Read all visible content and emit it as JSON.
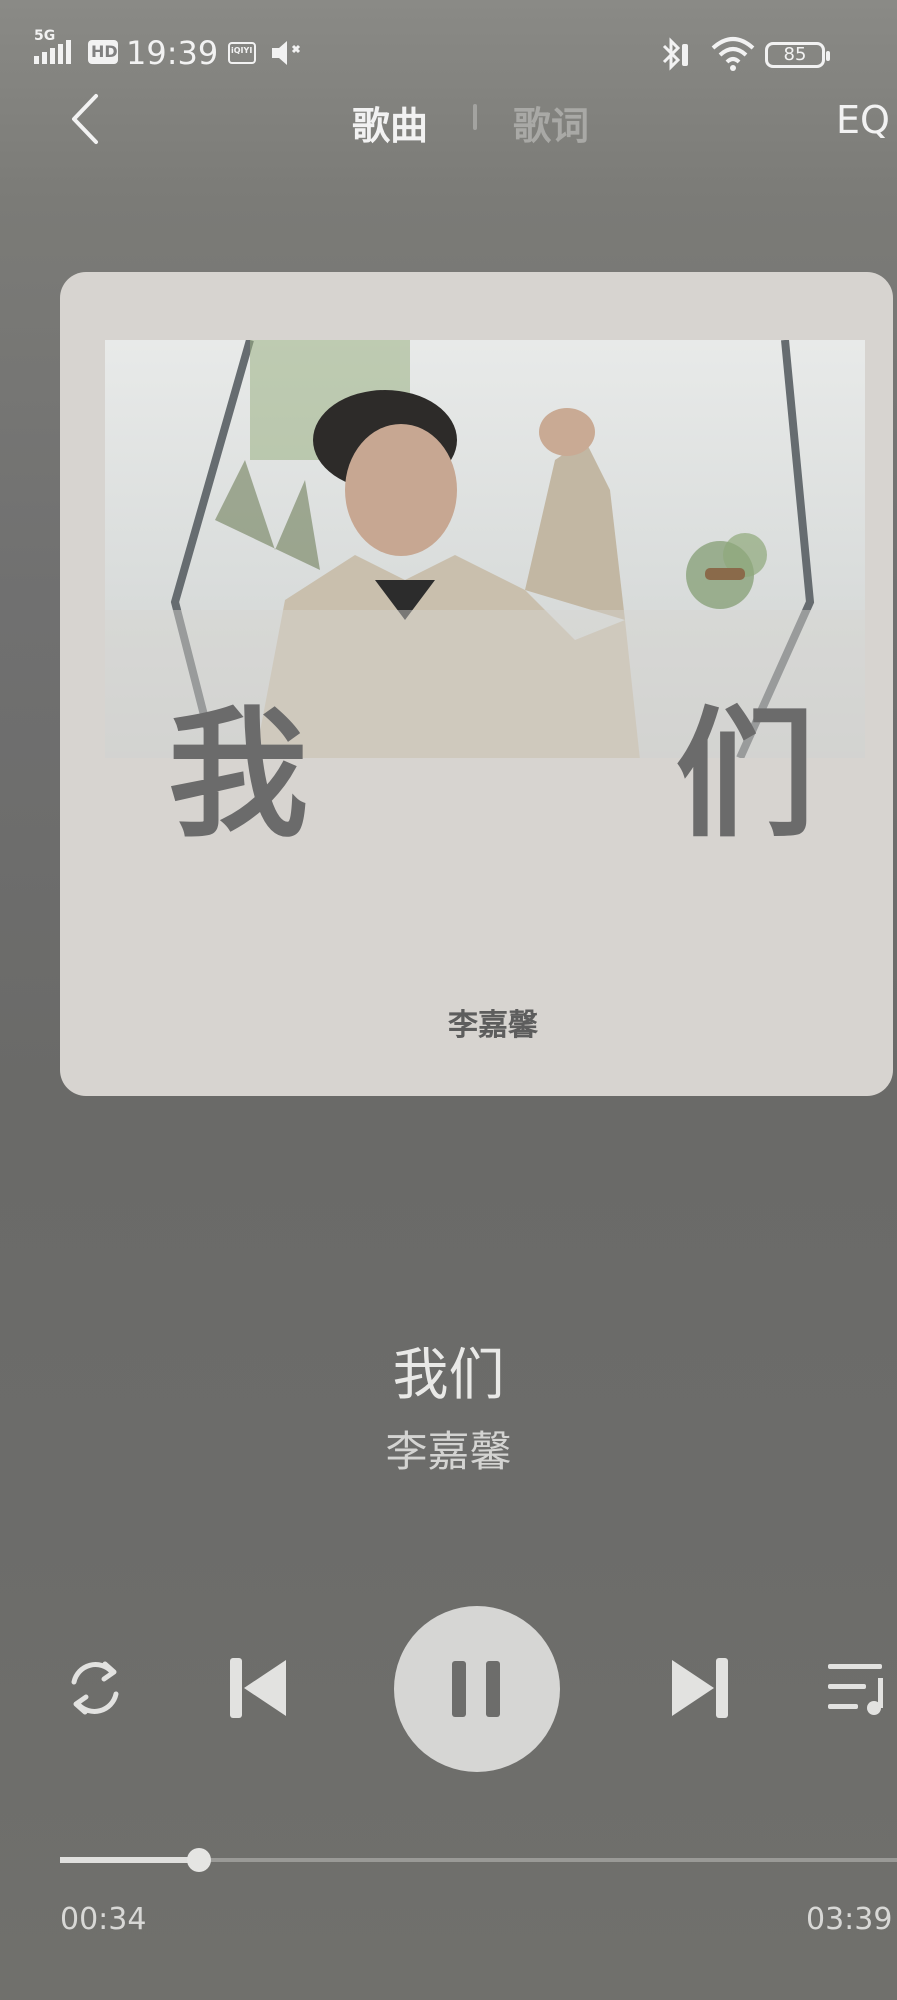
{
  "status_bar": {
    "network": "5G",
    "hd": "HD",
    "time": "19:39",
    "app_badge": "iQIYI",
    "battery": "85"
  },
  "header": {
    "tab_song": "歌曲",
    "tab_lyrics": "歌词",
    "eq": "EQ"
  },
  "album": {
    "cover_char_1": "我",
    "cover_char_2": "们",
    "cover_artist": "李嘉馨"
  },
  "song": {
    "title": "我们",
    "artist": "李嘉馨"
  },
  "player": {
    "current_time": "00:34",
    "total_time": "03:39",
    "progress": 0.155
  },
  "icons": [
    "back-icon",
    "repeat-icon",
    "previous-icon",
    "pause-icon",
    "next-icon",
    "playlist-icon",
    "bluetooth-icon",
    "wifi-icon",
    "speaker-icon",
    "battery-icon"
  ]
}
